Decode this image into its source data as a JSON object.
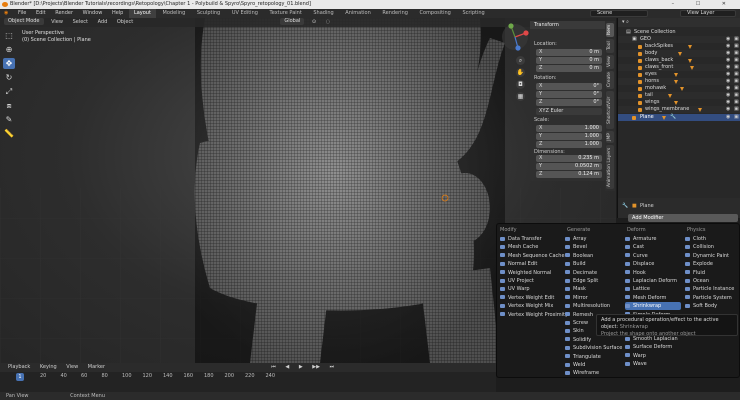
{
  "titlebar": {
    "title": "Blender* [D:\\Projects\\Blender Tutorials\\recordings\\Retopology\\Chapter 1 - Polybuild & Spyro\\Spyro_retopology_01.blend]",
    "win_buttons": "– ☐ ✕"
  },
  "menubar": {
    "menus": [
      "File",
      "Edit",
      "Render",
      "Window",
      "Help"
    ],
    "workspaces": [
      "Layout",
      "Modeling",
      "Sculpting",
      "UV Editing",
      "Texture Paint",
      "Shading",
      "Animation",
      "Rendering",
      "Compositing",
      "Scripting"
    ],
    "scene": "Scene",
    "view_layer": "View Layer"
  },
  "viewport": {
    "mode": "Object Mode",
    "menus": [
      "View",
      "Select",
      "Add",
      "Object"
    ],
    "orientation": "Global",
    "info_line1": "User Perspective",
    "info_line2": "(0) Scene Collection | Plane"
  },
  "npanel": {
    "header": "Transform",
    "location_label": "Location:",
    "rotation_label": "Rotation:",
    "rotation_mode": "XYZ Euler",
    "scale_label": "Scale:",
    "dimensions_label": "Dimensions:",
    "location": [
      {
        "ax": "X",
        "v": "0 m"
      },
      {
        "ax": "Y",
        "v": "0 m"
      },
      {
        "ax": "Z",
        "v": "0 m"
      }
    ],
    "rotation": [
      {
        "ax": "X",
        "v": "0°"
      },
      {
        "ax": "Y",
        "v": "0°"
      },
      {
        "ax": "Z",
        "v": "0°"
      }
    ],
    "scale": [
      {
        "ax": "X",
        "v": "1.000"
      },
      {
        "ax": "Y",
        "v": "1.000"
      },
      {
        "ax": "Z",
        "v": "1.000"
      }
    ],
    "dimensions": [
      {
        "ax": "X",
        "v": "0.235 m"
      },
      {
        "ax": "Y",
        "v": "0.0502 m"
      },
      {
        "ax": "Z",
        "v": "0.124 m"
      }
    ],
    "tabs": [
      "Item",
      "Tool",
      "View",
      "Create",
      "ShortcutVUr",
      "JMP",
      "Animation Layers"
    ]
  },
  "outliner": {
    "root": "Scene Collection",
    "items": [
      "GEO",
      "backSpikes",
      "body",
      "claws_back",
      "claws_front",
      "eyes",
      "horns",
      "mohawk",
      "tail",
      "wings",
      "wings_membrane",
      "Plane"
    ]
  },
  "props": {
    "object": "Plane",
    "add_modifier": "Add Modifier"
  },
  "modmenu": {
    "headers": [
      "Modify",
      "Generate",
      "Deform",
      "Physics"
    ],
    "modify": [
      "Data Transfer",
      "Mesh Cache",
      "Mesh Sequence Cache",
      "Normal Edit",
      "Weighted Normal",
      "UV Project",
      "UV Warp",
      "Vertex Weight Edit",
      "Vertex Weight Mix",
      "Vertex Weight Proximity"
    ],
    "generate": [
      "Array",
      "Bevel",
      "Boolean",
      "Build",
      "Decimate",
      "Edge Split",
      "Mask",
      "Mirror",
      "Multiresolution",
      "Remesh",
      "Screw",
      "Skin",
      "Solidify",
      "Subdivision Surface",
      "Triangulate",
      "Weld",
      "Wireframe"
    ],
    "deform": [
      "Armature",
      "Cast",
      "Curve",
      "Displace",
      "Hook",
      "Laplacian Deform",
      "Lattice",
      "Mesh Deform",
      "Shrinkwrap",
      "Simple Deform"
    ],
    "deform_lower": [
      "Smooth Laplacian",
      "Surface Deform",
      "Warp",
      "Wave"
    ],
    "physics": [
      "Cloth",
      "Collision",
      "Dynamic Paint",
      "Explode",
      "Fluid",
      "Ocean",
      "Particle Instance",
      "Particle System",
      "Soft Body"
    ],
    "tooltip_line1": "Add a procedural operation/effect to the active object:",
    "tooltip_key": "Shrinkwrap",
    "tooltip_line2": "Project the shape onto another object"
  },
  "timeline": {
    "menus": [
      "Playback",
      "Keying",
      "View",
      "Marker"
    ],
    "current_frame": "1",
    "ticks": [
      "20",
      "40",
      "60",
      "80",
      "100",
      "120",
      "140",
      "160",
      "180",
      "200",
      "220",
      "240"
    ]
  },
  "statusbar": {
    "items": [
      "Pan View",
      "Context Menu"
    ]
  }
}
